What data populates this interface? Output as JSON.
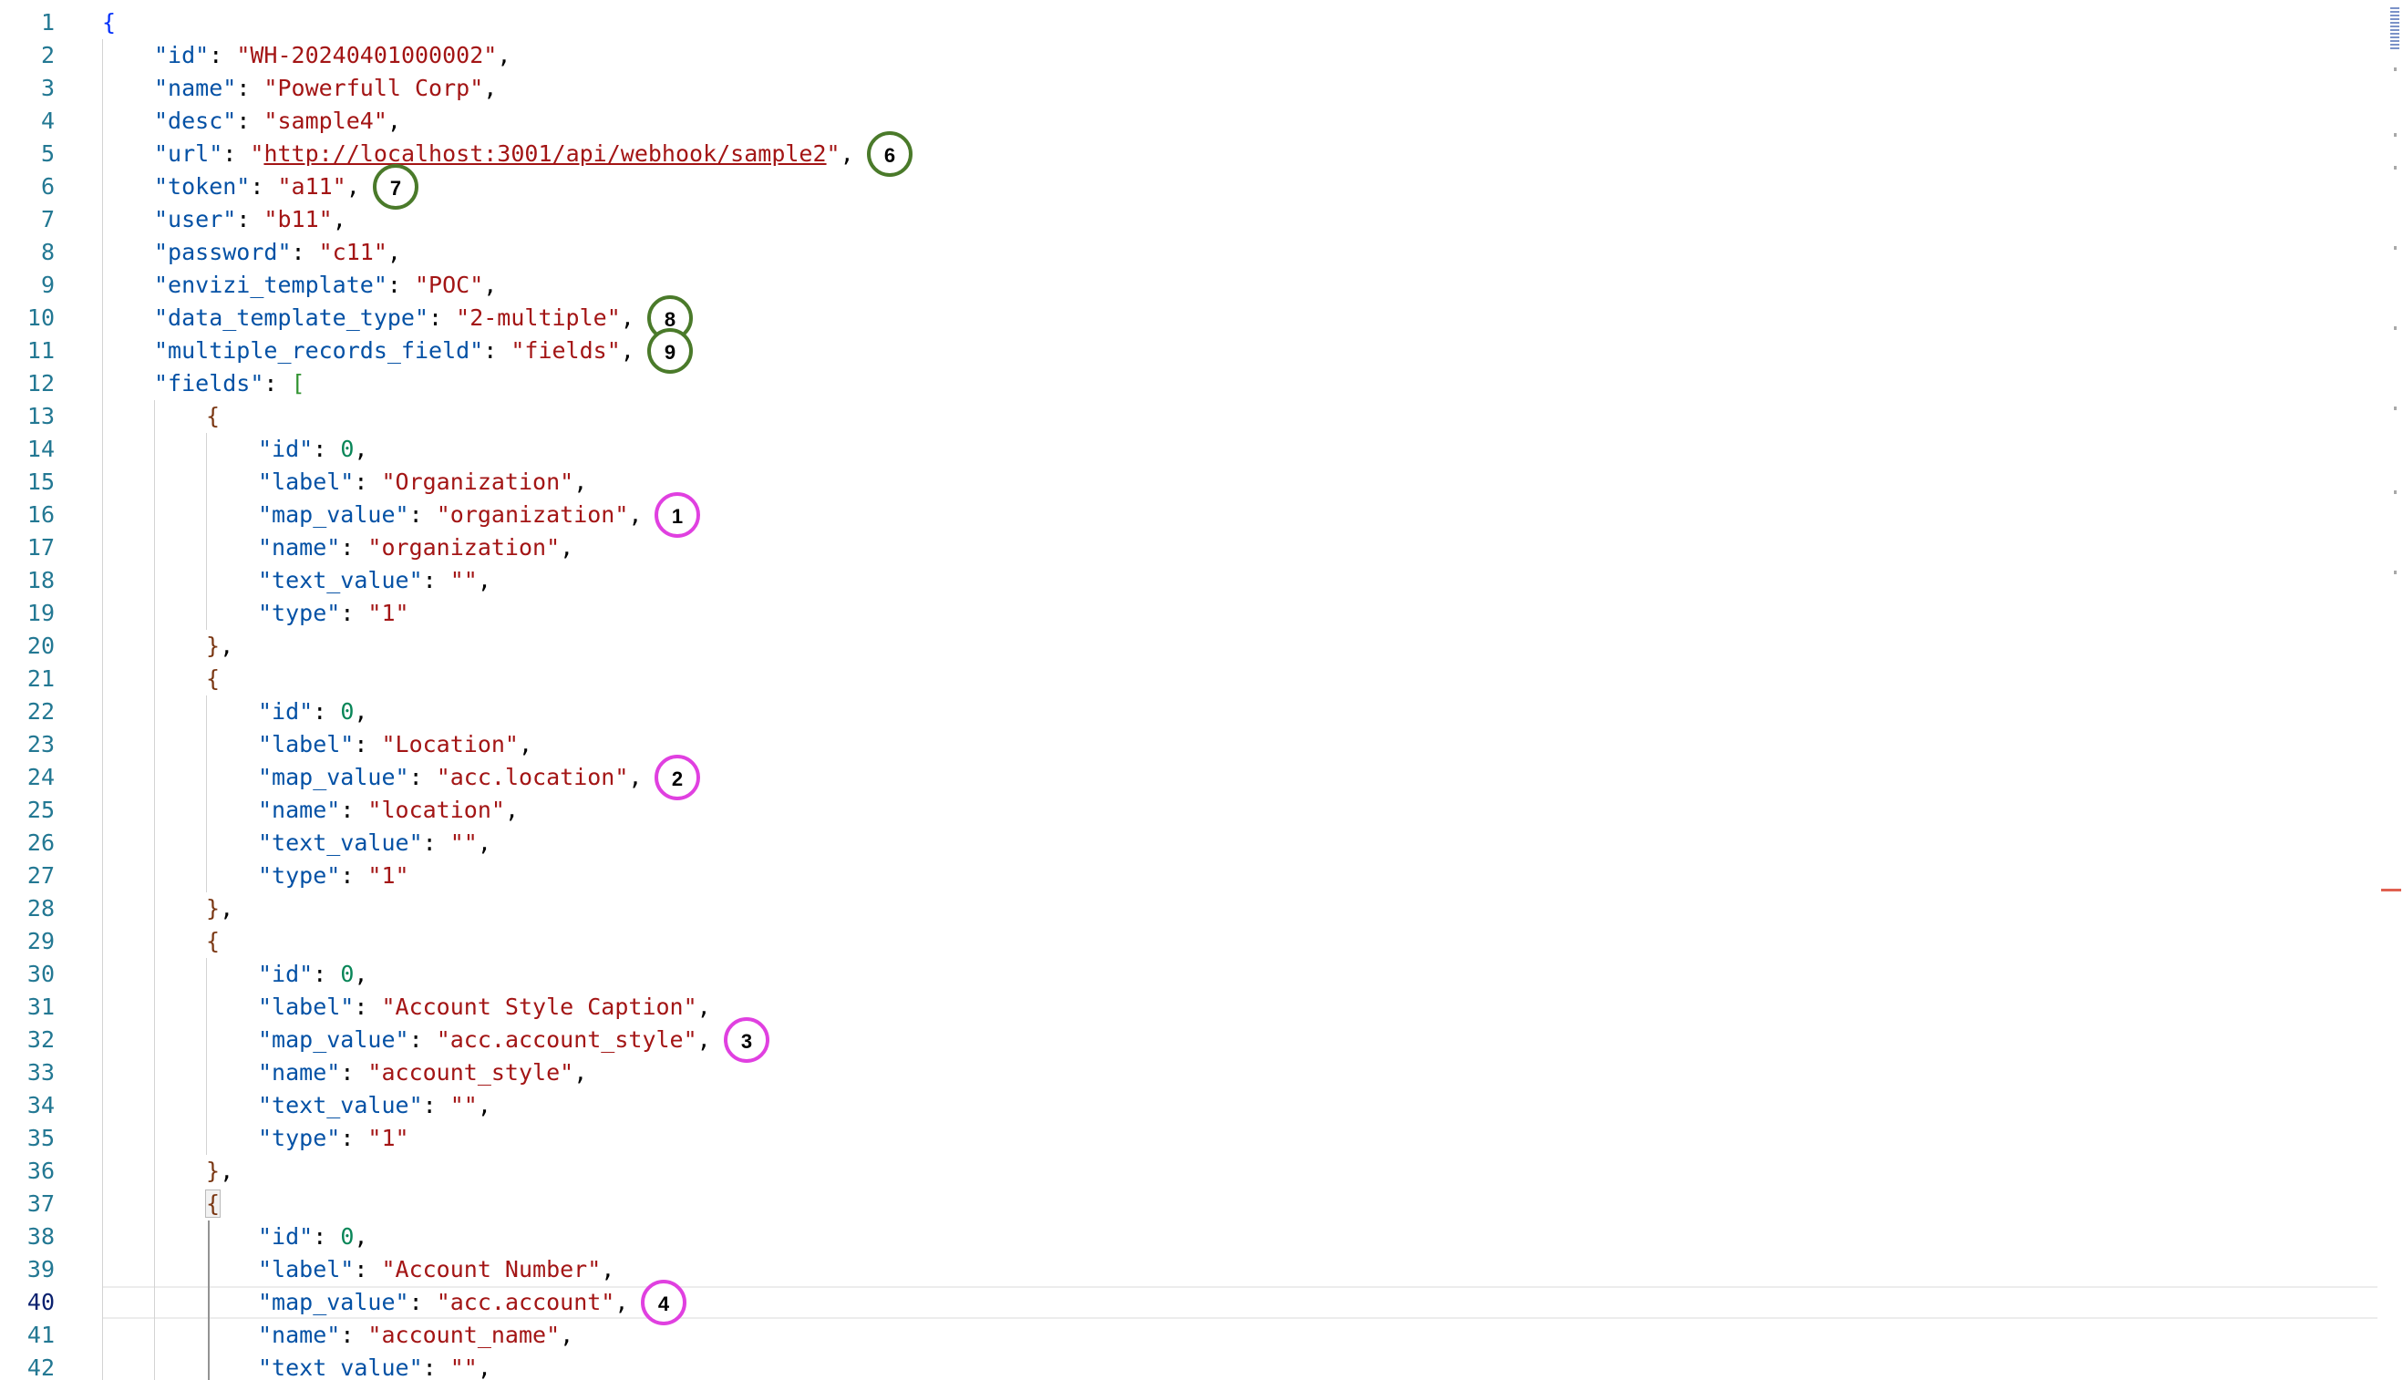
{
  "editor": {
    "lines": [
      {
        "num": "1",
        "level": 0,
        "tokens": [
          {
            "t": "{",
            "c": "brace"
          }
        ]
      },
      {
        "num": "2",
        "level": 1,
        "tokens": [
          {
            "t": "\"id\"",
            "c": "key"
          },
          {
            "t": ": ",
            "c": "pun"
          },
          {
            "t": "\"WH-20240401000002\"",
            "c": "str"
          },
          {
            "t": ",",
            "c": "pun"
          }
        ]
      },
      {
        "num": "3",
        "level": 1,
        "tokens": [
          {
            "t": "\"name\"",
            "c": "key"
          },
          {
            "t": ": ",
            "c": "pun"
          },
          {
            "t": "\"Powerfull Corp\"",
            "c": "str"
          },
          {
            "t": ",",
            "c": "pun"
          }
        ]
      },
      {
        "num": "4",
        "level": 1,
        "tokens": [
          {
            "t": "\"desc\"",
            "c": "key"
          },
          {
            "t": ": ",
            "c": "pun"
          },
          {
            "t": "\"sample4\"",
            "c": "str"
          },
          {
            "t": ",",
            "c": "pun"
          }
        ]
      },
      {
        "num": "5",
        "level": 1,
        "tokens": [
          {
            "t": "\"url\"",
            "c": "key"
          },
          {
            "t": ": ",
            "c": "pun"
          },
          {
            "t": "\"",
            "c": "str"
          },
          {
            "t": "http://localhost:3001/api/webhook/sample2",
            "c": "str link",
            "i": true
          },
          {
            "t": "\"",
            "c": "str"
          },
          {
            "t": ",",
            "c": "pun"
          }
        ]
      },
      {
        "num": "6",
        "level": 1,
        "tokens": [
          {
            "t": "\"token\"",
            "c": "key"
          },
          {
            "t": ": ",
            "c": "pun"
          },
          {
            "t": "\"a11\"",
            "c": "str"
          },
          {
            "t": ",",
            "c": "pun"
          }
        ]
      },
      {
        "num": "7",
        "level": 1,
        "tokens": [
          {
            "t": "\"user\"",
            "c": "key"
          },
          {
            "t": ": ",
            "c": "pun"
          },
          {
            "t": "\"b11\"",
            "c": "str"
          },
          {
            "t": ",",
            "c": "pun"
          }
        ]
      },
      {
        "num": "8",
        "level": 1,
        "tokens": [
          {
            "t": "\"password\"",
            "c": "key"
          },
          {
            "t": ": ",
            "c": "pun"
          },
          {
            "t": "\"c11\"",
            "c": "str"
          },
          {
            "t": ",",
            "c": "pun"
          }
        ]
      },
      {
        "num": "9",
        "level": 1,
        "tokens": [
          {
            "t": "\"envizi_template\"",
            "c": "key"
          },
          {
            "t": ": ",
            "c": "pun"
          },
          {
            "t": "\"POC\"",
            "c": "str"
          },
          {
            "t": ",",
            "c": "pun"
          }
        ]
      },
      {
        "num": "10",
        "level": 1,
        "tokens": [
          {
            "t": "\"data_template_type\"",
            "c": "key"
          },
          {
            "t": ": ",
            "c": "pun"
          },
          {
            "t": "\"2-multiple\"",
            "c": "str"
          },
          {
            "t": ",",
            "c": "pun"
          }
        ]
      },
      {
        "num": "11",
        "level": 1,
        "tokens": [
          {
            "t": "\"multiple_records_field\"",
            "c": "key"
          },
          {
            "t": ": ",
            "c": "pun"
          },
          {
            "t": "\"fields\"",
            "c": "str"
          },
          {
            "t": ",",
            "c": "pun"
          }
        ]
      },
      {
        "num": "12",
        "level": 1,
        "tokens": [
          {
            "t": "\"fields\"",
            "c": "key"
          },
          {
            "t": ": ",
            "c": "pun"
          },
          {
            "t": "[",
            "c": "brace2"
          }
        ]
      },
      {
        "num": "13",
        "level": 2,
        "tokens": [
          {
            "t": "{",
            "c": "brace3"
          }
        ]
      },
      {
        "num": "14",
        "level": 3,
        "tokens": [
          {
            "t": "\"id\"",
            "c": "key"
          },
          {
            "t": ": ",
            "c": "pun"
          },
          {
            "t": "0",
            "c": "num"
          },
          {
            "t": ",",
            "c": "pun"
          }
        ]
      },
      {
        "num": "15",
        "level": 3,
        "tokens": [
          {
            "t": "\"label\"",
            "c": "key"
          },
          {
            "t": ": ",
            "c": "pun"
          },
          {
            "t": "\"Organization\"",
            "c": "str"
          },
          {
            "t": ",",
            "c": "pun"
          }
        ]
      },
      {
        "num": "16",
        "level": 3,
        "tokens": [
          {
            "t": "\"map_value\"",
            "c": "key"
          },
          {
            "t": ": ",
            "c": "pun"
          },
          {
            "t": "\"organization\"",
            "c": "str"
          },
          {
            "t": ",",
            "c": "pun"
          }
        ]
      },
      {
        "num": "17",
        "level": 3,
        "tokens": [
          {
            "t": "\"name\"",
            "c": "key"
          },
          {
            "t": ": ",
            "c": "pun"
          },
          {
            "t": "\"organization\"",
            "c": "str"
          },
          {
            "t": ",",
            "c": "pun"
          }
        ]
      },
      {
        "num": "18",
        "level": 3,
        "tokens": [
          {
            "t": "\"text_value\"",
            "c": "key"
          },
          {
            "t": ": ",
            "c": "pun"
          },
          {
            "t": "\"\"",
            "c": "str"
          },
          {
            "t": ",",
            "c": "pun"
          }
        ]
      },
      {
        "num": "19",
        "level": 3,
        "tokens": [
          {
            "t": "\"type\"",
            "c": "key"
          },
          {
            "t": ": ",
            "c": "pun"
          },
          {
            "t": "\"1\"",
            "c": "str"
          }
        ]
      },
      {
        "num": "20",
        "level": 2,
        "tokens": [
          {
            "t": "}",
            "c": "brace3"
          },
          {
            "t": ",",
            "c": "pun"
          }
        ]
      },
      {
        "num": "21",
        "level": 2,
        "tokens": [
          {
            "t": "{",
            "c": "brace3"
          }
        ]
      },
      {
        "num": "22",
        "level": 3,
        "tokens": [
          {
            "t": "\"id\"",
            "c": "key"
          },
          {
            "t": ": ",
            "c": "pun"
          },
          {
            "t": "0",
            "c": "num"
          },
          {
            "t": ",",
            "c": "pun"
          }
        ]
      },
      {
        "num": "23",
        "level": 3,
        "tokens": [
          {
            "t": "\"label\"",
            "c": "key"
          },
          {
            "t": ": ",
            "c": "pun"
          },
          {
            "t": "\"Location\"",
            "c": "str"
          },
          {
            "t": ",",
            "c": "pun"
          }
        ]
      },
      {
        "num": "24",
        "level": 3,
        "tokens": [
          {
            "t": "\"map_value\"",
            "c": "key"
          },
          {
            "t": ": ",
            "c": "pun"
          },
          {
            "t": "\"acc.location\"",
            "c": "str"
          },
          {
            "t": ",",
            "c": "pun"
          }
        ]
      },
      {
        "num": "25",
        "level": 3,
        "tokens": [
          {
            "t": "\"name\"",
            "c": "key"
          },
          {
            "t": ": ",
            "c": "pun"
          },
          {
            "t": "\"location\"",
            "c": "str"
          },
          {
            "t": ",",
            "c": "pun"
          }
        ]
      },
      {
        "num": "26",
        "level": 3,
        "tokens": [
          {
            "t": "\"text_value\"",
            "c": "key"
          },
          {
            "t": ": ",
            "c": "pun"
          },
          {
            "t": "\"\"",
            "c": "str"
          },
          {
            "t": ",",
            "c": "pun"
          }
        ]
      },
      {
        "num": "27",
        "level": 3,
        "tokens": [
          {
            "t": "\"type\"",
            "c": "key"
          },
          {
            "t": ": ",
            "c": "pun"
          },
          {
            "t": "\"1\"",
            "c": "str"
          }
        ]
      },
      {
        "num": "28",
        "level": 2,
        "tokens": [
          {
            "t": "}",
            "c": "brace3"
          },
          {
            "t": ",",
            "c": "pun"
          }
        ]
      },
      {
        "num": "29",
        "level": 2,
        "tokens": [
          {
            "t": "{",
            "c": "brace3"
          }
        ]
      },
      {
        "num": "30",
        "level": 3,
        "tokens": [
          {
            "t": "\"id\"",
            "c": "key"
          },
          {
            "t": ": ",
            "c": "pun"
          },
          {
            "t": "0",
            "c": "num"
          },
          {
            "t": ",",
            "c": "pun"
          }
        ]
      },
      {
        "num": "31",
        "level": 3,
        "tokens": [
          {
            "t": "\"label\"",
            "c": "key"
          },
          {
            "t": ": ",
            "c": "pun"
          },
          {
            "t": "\"Account Style Caption\"",
            "c": "str"
          },
          {
            "t": ",",
            "c": "pun"
          }
        ]
      },
      {
        "num": "32",
        "level": 3,
        "tokens": [
          {
            "t": "\"map_value\"",
            "c": "key"
          },
          {
            "t": ": ",
            "c": "pun"
          },
          {
            "t": "\"acc.account_style\"",
            "c": "str"
          },
          {
            "t": ",",
            "c": "pun"
          }
        ]
      },
      {
        "num": "33",
        "level": 3,
        "tokens": [
          {
            "t": "\"name\"",
            "c": "key"
          },
          {
            "t": ": ",
            "c": "pun"
          },
          {
            "t": "\"account_style\"",
            "c": "str"
          },
          {
            "t": ",",
            "c": "pun"
          }
        ]
      },
      {
        "num": "34",
        "level": 3,
        "tokens": [
          {
            "t": "\"text_value\"",
            "c": "key"
          },
          {
            "t": ": ",
            "c": "pun"
          },
          {
            "t": "\"\"",
            "c": "str"
          },
          {
            "t": ",",
            "c": "pun"
          }
        ]
      },
      {
        "num": "35",
        "level": 3,
        "tokens": [
          {
            "t": "\"type\"",
            "c": "key"
          },
          {
            "t": ": ",
            "c": "pun"
          },
          {
            "t": "\"1\"",
            "c": "str"
          }
        ]
      },
      {
        "num": "36",
        "level": 2,
        "tokens": [
          {
            "t": "}",
            "c": "brace3"
          },
          {
            "t": ",",
            "c": "pun"
          }
        ]
      },
      {
        "num": "37",
        "level": 2,
        "tokens": [
          {
            "t": "{",
            "c": "brace3 bracket-match"
          }
        ]
      },
      {
        "num": "38",
        "level": 3,
        "tokens": [
          {
            "t": "\"id\"",
            "c": "key"
          },
          {
            "t": ": ",
            "c": "pun"
          },
          {
            "t": "0",
            "c": "num"
          },
          {
            "t": ",",
            "c": "pun"
          }
        ]
      },
      {
        "num": "39",
        "level": 3,
        "tokens": [
          {
            "t": "\"label\"",
            "c": "key"
          },
          {
            "t": ": ",
            "c": "pun"
          },
          {
            "t": "\"Account Number\"",
            "c": "str"
          },
          {
            "t": ",",
            "c": "pun"
          }
        ]
      },
      {
        "num": "40",
        "level": 3,
        "current": true,
        "tokens": [
          {
            "t": "\"map_value\"",
            "c": "key"
          },
          {
            "t": ": ",
            "c": "pun"
          },
          {
            "t": "\"acc.account\"",
            "c": "str"
          },
          {
            "t": ",",
            "c": "pun"
          }
        ]
      },
      {
        "num": "41",
        "level": 3,
        "tokens": [
          {
            "t": "\"name\"",
            "c": "key"
          },
          {
            "t": ": ",
            "c": "pun"
          },
          {
            "t": "\"account_name\"",
            "c": "str"
          },
          {
            "t": ",",
            "c": "pun"
          }
        ]
      },
      {
        "num": "42",
        "level": 3,
        "tokens": [
          {
            "t": "\"text_value\"",
            "c": "key"
          },
          {
            "t": ": ",
            "c": "pun"
          },
          {
            "t": "\"\"",
            "c": "str"
          },
          {
            "t": ","
          }
        ]
      }
    ]
  },
  "annotations": [
    {
      "label": "6",
      "line": 5,
      "style": "green"
    },
    {
      "label": "7",
      "line": 6,
      "style": "green"
    },
    {
      "label": "8",
      "line": 10,
      "style": "green"
    },
    {
      "label": "9",
      "line": 11,
      "style": "green"
    },
    {
      "label": "1",
      "line": 16,
      "style": "magenta"
    },
    {
      "label": "2",
      "line": 24,
      "style": "magenta"
    },
    {
      "label": "3",
      "line": 32,
      "style": "magenta"
    },
    {
      "label": "4",
      "line": 40,
      "style": "magenta"
    }
  ],
  "colors": {
    "line_number": "#237893",
    "key": "#0451a5",
    "string": "#a31515",
    "number": "#098658",
    "annotation_green": "#4a7a2a",
    "annotation_magenta": "#e040e0"
  }
}
